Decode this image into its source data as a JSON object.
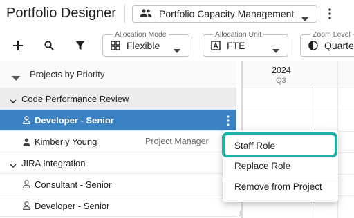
{
  "app": {
    "title": "Portfolio Designer"
  },
  "view_selector": {
    "value": "Portfolio Capacity Management",
    "icon": "people-icon"
  },
  "toolbar": {
    "add_icon": "add-icon",
    "search_icon": "search-icon",
    "filter_icon": "filter-icon",
    "fields": [
      {
        "label": "Allocation Mode",
        "value": "Flexible",
        "icon": "grid-icon"
      },
      {
        "label": "Allocation Unit",
        "value": "FTE",
        "icon": "a-box-icon"
      },
      {
        "label": "Zoom Level",
        "value": "Quarte",
        "icon": "half-circle-icon"
      }
    ]
  },
  "tree": {
    "header": "Projects by Priority",
    "rows": [
      {
        "type": "group",
        "label": "Code Performance Review"
      },
      {
        "type": "role",
        "label": "Developer - Senior",
        "selected": true
      },
      {
        "type": "person",
        "label": "Kimberly Young",
        "sub": "Project Manager"
      },
      {
        "type": "group",
        "label": "JIRA Integration"
      },
      {
        "type": "role",
        "label": "Consultant - Senior"
      },
      {
        "type": "role",
        "label": "Developer - Senior"
      }
    ]
  },
  "timeline": {
    "year": "2024",
    "quarter": "Q3"
  },
  "context_menu": {
    "items": [
      "Staff Role",
      "Replace Role",
      "Remove from Project"
    ],
    "highlighted": "Staff Role",
    "highlight_color": "#1db3a4"
  },
  "colors": {
    "selected_row": "#3b82c4",
    "today_line": "#c0392b"
  }
}
